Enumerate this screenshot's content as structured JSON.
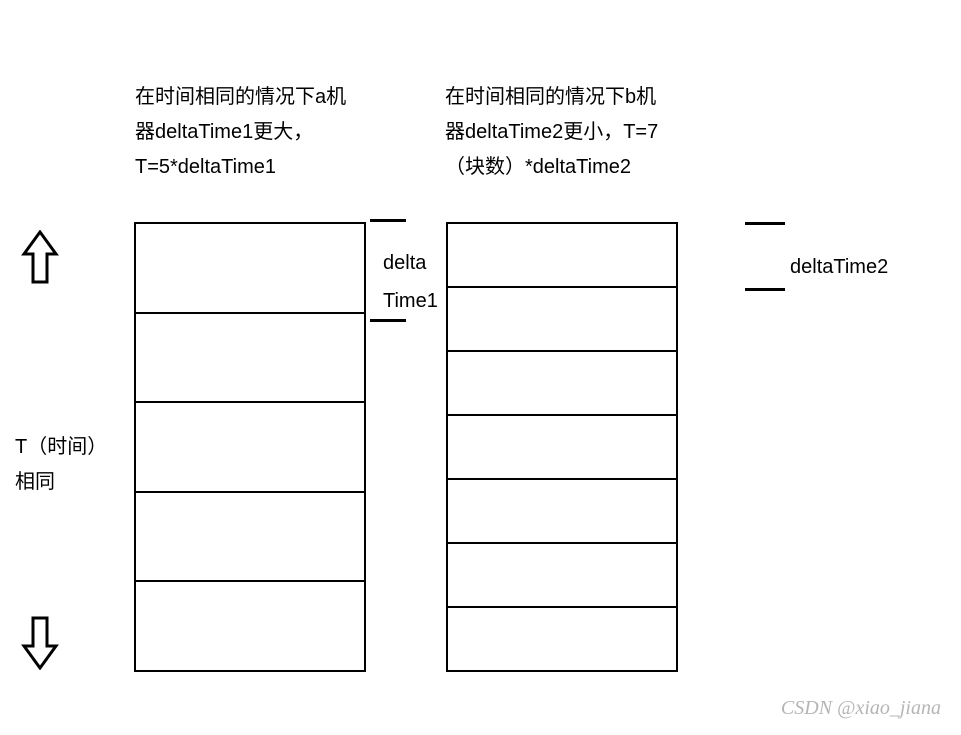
{
  "caption_a": "在时间相同的情况下a机器deltaTime1更大，T=5*deltaTime1",
  "caption_b": "在时间相同的情况下b机器deltaTime2更小，T=7（块数）*deltaTime2",
  "left_label_line1": "T（时间）",
  "left_label_line2": "相同",
  "delta1_line1": "delta",
  "delta1_line2": "Time1",
  "delta2_label": "deltaTime2",
  "watermark": "CSDN @xiao_jiana",
  "chart_data": {
    "type": "table",
    "description": "Two vertical stacks representing time T divided into segments of deltaTime on two machines a and b. Same total T, different segment counts.",
    "machines": [
      {
        "name": "a",
        "segments": 5,
        "segment_label": "deltaTime1",
        "formula": "T=5*deltaTime1"
      },
      {
        "name": "b",
        "segments": 7,
        "segment_label": "deltaTime2",
        "formula": "T=7（块数）*deltaTime2"
      }
    ],
    "total_time_label": "T（时间）相同"
  }
}
